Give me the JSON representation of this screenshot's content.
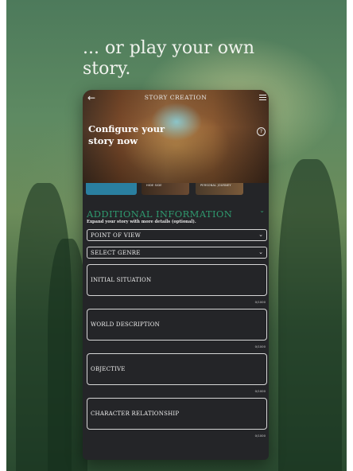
{
  "promo": {
    "headline": "... or play your own story."
  },
  "app": {
    "title": "STORY CREATION",
    "hero_title": "Configure your story now",
    "card_tabs": [
      "",
      "HIDE SIDE",
      "PERSONAL JOURNEY"
    ]
  },
  "additional": {
    "title": "ADDITIONAL INFORMATION",
    "subtitle": "Expand your story with more details (optional).",
    "point_of_view": "POINT OF VIEW",
    "genre": "SELECT GENRE"
  },
  "fields": [
    {
      "label": "INITIAL SITUATION",
      "counter": "0/1000"
    },
    {
      "label": "WORLD DESCRIPTION",
      "counter": "0/1000"
    },
    {
      "label": "OBJECTIVE",
      "counter": "0/1000"
    },
    {
      "label": "CHARACTER RELATIONSHIP",
      "counter": "0/1000"
    }
  ],
  "colors": {
    "accent": "#2f9a6f",
    "panel": "#242528",
    "card_selected": "#2a7fa0"
  },
  "icons": [
    "back-arrow-icon",
    "menu-icon",
    "help-icon",
    "chevron-down-icon"
  ]
}
